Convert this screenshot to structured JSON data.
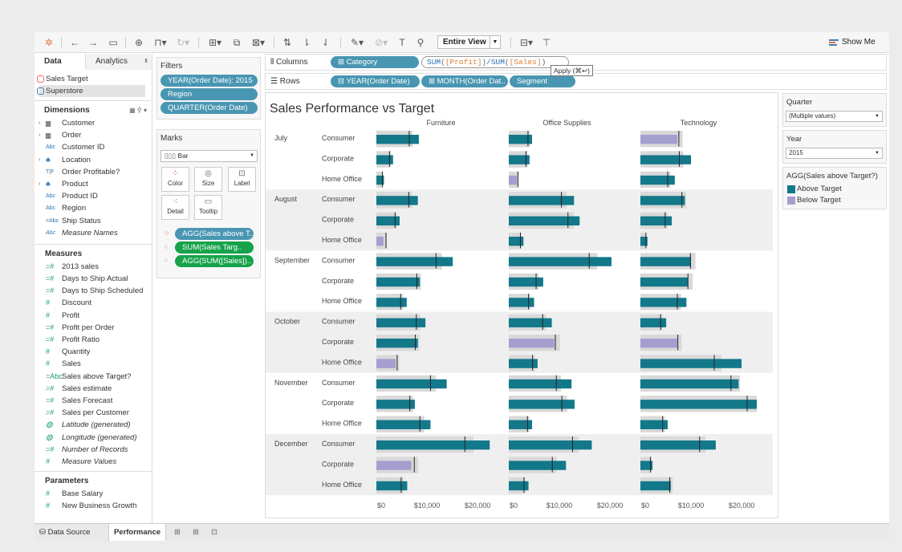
{
  "toolbar": {
    "view_fit": "Entire View",
    "show_me": "Show Me"
  },
  "left_panel": {
    "tabs": [
      "Data",
      "Analytics"
    ],
    "datasources": [
      "Sales Target",
      "Superstore"
    ],
    "dimensions_title": "Dimensions",
    "dimensions": [
      {
        "label": "Customer",
        "icon": "folder",
        "expand": true
      },
      {
        "label": "Order",
        "icon": "folder",
        "expand": true
      },
      {
        "label": "Customer ID",
        "icon": "Abc"
      },
      {
        "label": "Location",
        "icon": "hierarchy",
        "expand": true
      },
      {
        "label": "Order Profitable?",
        "icon": "T|F"
      },
      {
        "label": "Product",
        "icon": "hierarchy",
        "expand": true
      },
      {
        "label": "Product ID",
        "icon": "Abc"
      },
      {
        "label": "Region",
        "icon": "Abc"
      },
      {
        "label": "Ship Status",
        "icon": "=Abc"
      },
      {
        "label": "Measure Names",
        "icon": "Abc",
        "italic": true
      }
    ],
    "measures_title": "Measures",
    "measures": [
      {
        "label": "2013 sales",
        "icon": "=#"
      },
      {
        "label": "Days to Ship Actual",
        "icon": "=#"
      },
      {
        "label": "Days to Ship Scheduled",
        "icon": "=#"
      },
      {
        "label": "Discount",
        "icon": "#"
      },
      {
        "label": "Profit",
        "icon": "#"
      },
      {
        "label": "Profit per Order",
        "icon": "=#"
      },
      {
        "label": "Profit Ratio",
        "icon": "=#"
      },
      {
        "label": "Quantity",
        "icon": "#"
      },
      {
        "label": "Sales",
        "icon": "#"
      },
      {
        "label": "Sales above Target?",
        "icon": "=Abc"
      },
      {
        "label": "Sales estimate",
        "icon": "=#"
      },
      {
        "label": "Sales Forecast",
        "icon": "=#"
      },
      {
        "label": "Sales per Customer",
        "icon": "=#"
      },
      {
        "label": "Latitude (generated)",
        "icon": "globe",
        "italic": true
      },
      {
        "label": "Longitude (generated)",
        "icon": "globe",
        "italic": true
      },
      {
        "label": "Number of Records",
        "icon": "=#",
        "italic": true
      },
      {
        "label": "Measure Values",
        "icon": "#",
        "italic": true
      }
    ],
    "parameters_title": "Parameters",
    "parameters": [
      {
        "label": "Base Salary",
        "icon": "#"
      },
      {
        "label": "New Business Growth",
        "icon": "#"
      }
    ]
  },
  "filters": {
    "title": "Filters",
    "items": [
      "YEAR(Order Date): 2015",
      "Region",
      "QUARTER(Order Date)"
    ]
  },
  "marks": {
    "title": "Marks",
    "type": "Bar",
    "buttons": [
      "Color",
      "Size",
      "Label",
      "Detail",
      "Tooltip"
    ],
    "fields": [
      {
        "label": "AGG(Sales above T..",
        "color": "blue"
      },
      {
        "label": "SUM(Sales Targ..",
        "color": "green"
      },
      {
        "label": "AGG(SUM([Sales])..",
        "color": "green"
      }
    ]
  },
  "shelves": {
    "columns_label": "Columns",
    "rows_label": "Rows",
    "columns": [
      "Category"
    ],
    "calc_parts": [
      "SUM(",
      "[Profit]",
      ")/SUM(",
      "[Sales]",
      ")"
    ],
    "apply_tip": "Apply (⌘↩)",
    "rows": [
      "YEAR(Order Date)",
      "MONTH(Order Dat..",
      "Segment"
    ]
  },
  "chart_data": {
    "type": "bar",
    "title": "Sales Performance vs Target",
    "columns": [
      "Furniture",
      "Office Supplies",
      "Technology"
    ],
    "months": [
      "July",
      "August",
      "September",
      "October",
      "November",
      "December"
    ],
    "segments": [
      "Consumer",
      "Corporate",
      "Home Office"
    ],
    "x_ticks": [
      "$0",
      "$10,000",
      "$20,000"
    ],
    "xlim": [
      0,
      23000
    ],
    "colors": {
      "above": "#12788a",
      "below": "#a49fcf",
      "reference": "#d9d9d9",
      "band": "#efefef"
    },
    "series_notes": "values are [sales, target] per segment",
    "data": {
      "Furniture": [
        [
          [
            8400,
            6500
          ],
          [
            3300,
            2600
          ],
          [
            1500,
            1200
          ]
        ],
        [
          [
            8200,
            6400
          ],
          [
            4600,
            3700
          ],
          [
            1400,
            1900
          ]
        ],
        [
          [
            15100,
            11800
          ],
          [
            8600,
            8000
          ],
          [
            6000,
            4800
          ]
        ],
        [
          [
            9700,
            7900
          ],
          [
            8200,
            7700
          ],
          [
            3800,
            4100
          ]
        ],
        [
          [
            13900,
            10700
          ],
          [
            7600,
            6600
          ],
          [
            10700,
            8600
          ]
        ],
        [
          [
            22400,
            17500
          ],
          [
            6900,
            7500
          ],
          [
            6100,
            4900
          ]
        ]
      ],
      "Office Supplies": [
        [
          [
            4600,
            3800
          ],
          [
            4100,
            3400
          ],
          [
            1600,
            1800
          ]
        ],
        [
          [
            12900,
            10400
          ],
          [
            14000,
            11700
          ],
          [
            2900,
            2300
          ]
        ],
        [
          [
            20300,
            15900
          ],
          [
            6800,
            5400
          ],
          [
            5000,
            3900
          ]
        ],
        [
          [
            8500,
            6700
          ],
          [
            9000,
            9200
          ],
          [
            5700,
            4700
          ]
        ],
        [
          [
            12400,
            9400
          ],
          [
            13000,
            10500
          ],
          [
            4600,
            3700
          ]
        ],
        [
          [
            16400,
            12600
          ],
          [
            11300,
            8600
          ],
          [
            3900,
            3000
          ]
        ]
      ],
      "Technology": [
        [
          [
            7300,
            7600
          ],
          [
            10000,
            7700
          ],
          [
            6800,
            5400
          ]
        ],
        [
          [
            8800,
            8200
          ],
          [
            6200,
            4900
          ],
          [
            1400,
            1100
          ]
        ],
        [
          [
            10000,
            9900
          ],
          [
            9400,
            9400
          ],
          [
            9100,
            7300
          ]
        ],
        [
          [
            5100,
            4000
          ],
          [
            7300,
            7400
          ],
          [
            20000,
            14600
          ]
        ],
        [
          [
            19400,
            17900
          ],
          [
            24600,
            21100
          ],
          [
            5400,
            4400
          ]
        ],
        [
          [
            14900,
            11700
          ],
          [
            2400,
            2000
          ],
          [
            6000,
            5800
          ]
        ]
      ]
    }
  },
  "right_panel": {
    "quarter_title": "Quarter",
    "quarter_value": "(Multiple values)",
    "year_title": "Year",
    "year_value": "2015",
    "legend_title": "AGG(Sales above Target?)",
    "legend": [
      {
        "label": "Above Target",
        "color": "#12788a"
      },
      {
        "label": "Below Target",
        "color": "#a49fcf"
      }
    ]
  },
  "bottom_tabs": [
    "Data Source",
    "Performance"
  ]
}
